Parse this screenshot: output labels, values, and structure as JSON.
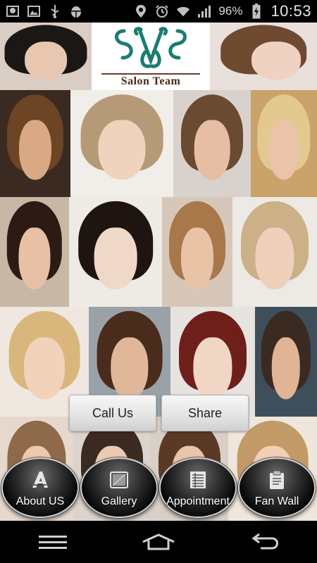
{
  "status_bar": {
    "battery": "96%",
    "time": "10:53",
    "icons": [
      "photo-icon",
      "image-icon",
      "usb-icon",
      "android-debug-icon",
      "location-icon",
      "alarm-icon",
      "wifi-icon",
      "signal-icon",
      "battery-icon"
    ]
  },
  "logo": {
    "text": "Salon Team",
    "mark_color": "#1a7d72",
    "text_color": "#4b2617"
  },
  "popup": {
    "call_label": "Call Us",
    "share_label": "Share"
  },
  "nav": [
    {
      "label": "About US",
      "icon": "about-logo-icon"
    },
    {
      "label": "Gallery",
      "icon": "gallery-icon"
    },
    {
      "label": "Appointment",
      "icon": "appointment-list-icon"
    },
    {
      "label": "Fan Wall",
      "icon": "fan-wall-clipboard-icon"
    }
  ],
  "system_nav": {
    "icons": [
      "recent-apps-icon",
      "home-icon",
      "back-icon"
    ]
  }
}
